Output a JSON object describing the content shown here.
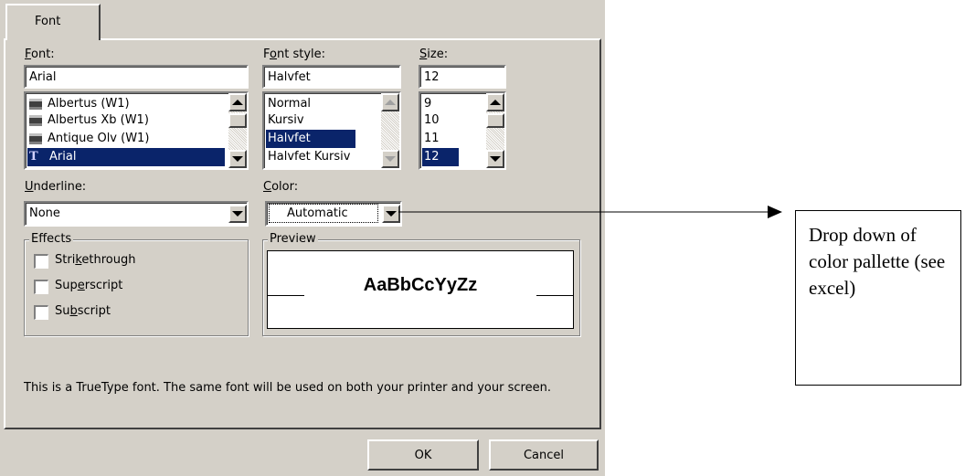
{
  "dialog": {
    "tab_label": "Font",
    "font": {
      "label": "Font:",
      "value": "Arial",
      "items": [
        "Albertus (W1)",
        "Albertus Xb (W1)",
        "Antique Olv (W1)",
        "Arial"
      ],
      "selected": "Arial"
    },
    "font_style": {
      "label": "Font style:",
      "value": "Halvfet",
      "items": [
        "Normal",
        "Kursiv",
        "Halvfet",
        "Halvfet Kursiv"
      ],
      "selected": "Halvfet"
    },
    "size": {
      "label": "Size:",
      "value": "12",
      "items": [
        "9",
        "10",
        "11",
        "12"
      ],
      "selected": "12"
    },
    "underline": {
      "label": "Underline:",
      "value": "None"
    },
    "color": {
      "label": "Color:",
      "value": "Automatic"
    },
    "effects": {
      "title": "Effects",
      "items": [
        "Strikethrough",
        "Superscript",
        "Subscript"
      ]
    },
    "preview": {
      "title": "Preview",
      "sample": "AaBbCcYyZz"
    },
    "info_text": "This is a TrueType font.  The same font will be used on both your printer and your screen.",
    "ok_label": "OK",
    "cancel_label": "Cancel"
  },
  "annotation": {
    "text": "Drop down of color pallette (see excel)"
  },
  "icons": [
    "printer-font-icon",
    "truetype-icon",
    "scroll-up-icon",
    "scroll-down-icon",
    "dropdown-arrow-icon",
    "arrow-right-icon"
  ],
  "colors": {
    "dialog_bg": "#d4d0c8",
    "selection": "#0a246a",
    "selection_text": "#ffffff"
  }
}
